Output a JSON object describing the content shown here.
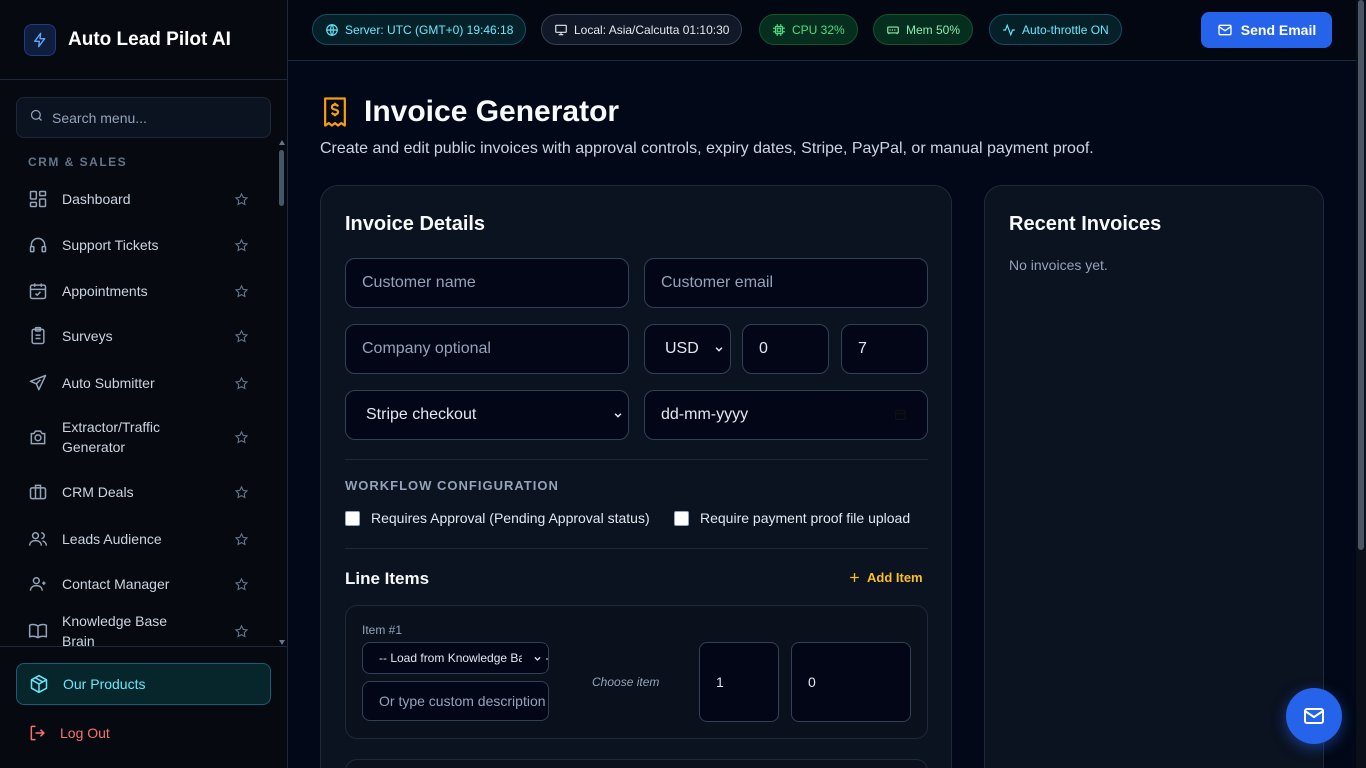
{
  "brand": {
    "name": "Auto Lead Pilot AI"
  },
  "sidebar": {
    "search_placeholder": "Search menu...",
    "section": "CRM & SALES",
    "items": [
      {
        "label": "Dashboard",
        "icon": "dashboard-icon"
      },
      {
        "label": "Support Tickets",
        "icon": "headset-icon"
      },
      {
        "label": "Appointments",
        "icon": "calendar-check-icon"
      },
      {
        "label": "Surveys",
        "icon": "clipboard-icon"
      },
      {
        "label": "Auto Submitter",
        "icon": "send-icon"
      },
      {
        "label": "Extractor/Traffic Generator",
        "icon": "camera-icon"
      },
      {
        "label": "CRM Deals",
        "icon": "briefcase-icon"
      },
      {
        "label": "Leads Audience",
        "icon": "users-icon"
      },
      {
        "label": "Contact Manager",
        "icon": "contacts-icon"
      },
      {
        "label": "Knowledge Base Brain",
        "icon": "book-icon"
      }
    ],
    "products_label": "Our Products",
    "logout_label": "Log Out"
  },
  "topbar": {
    "server": "Server: UTC (GMT+0) 19:46:18",
    "local": "Local: Asia/Calcutta 01:10:30",
    "cpu": "CPU 32%",
    "mem": "Mem 50%",
    "auto_throttle": "Auto-throttle ON",
    "send_email": "Send Email"
  },
  "page": {
    "title": "Invoice Generator",
    "subtitle": "Create and edit public invoices with approval controls, expiry dates, Stripe, PayPal, or manual payment proof."
  },
  "invoice": {
    "heading": "Invoice Details",
    "customer_name_placeholder": "Customer name",
    "customer_email_placeholder": "Customer email",
    "company_placeholder": "Company optional",
    "currency": "USD",
    "field_a": "0",
    "field_b": "7",
    "payment_method": "Stripe checkout",
    "date_placeholder": "dd-mm-yyyy",
    "workflow_label": "WORKFLOW CONFIGURATION",
    "requires_approval": "Requires Approval (Pending Approval status)",
    "require_proof": "Require payment proof file upload",
    "line_items_title": "Line Items",
    "add_item": "Add Item",
    "item": {
      "number": "Item #1",
      "kb_select": "-- Load from Knowledge Base --",
      "custom_placeholder": "Or type custom description",
      "choose": "Choose item",
      "qty": "1",
      "price": "0"
    }
  },
  "recent": {
    "heading": "Recent Invoices",
    "empty": "No invoices yet."
  },
  "colors": {
    "accent": "#2563eb",
    "background": "#020817",
    "card": "#0b1220",
    "warning": "#fbbf24",
    "danger": "#f87171"
  }
}
